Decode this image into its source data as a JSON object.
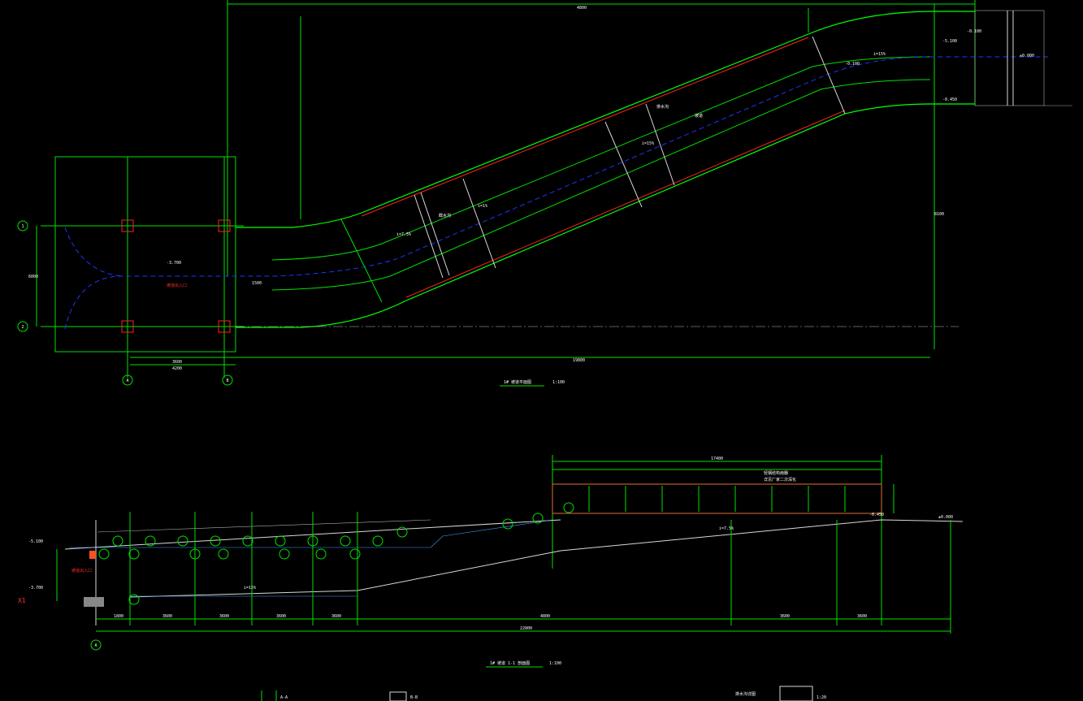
{
  "drawing": {
    "plan_title": "1# 坡道平面图",
    "plan_scale": "1:100",
    "section_title": "1# 坡道 1-1 剖面图",
    "section_scale": "1:100",
    "plan_axis_left_top": "1",
    "plan_axis_left_bottom": "2",
    "plan_axis_bottom_a": "A",
    "plan_axis_bottom_b": "B",
    "section_axis": "A",
    "plan_red_label": "坡道出入口",
    "section_red_label": "坡道出入口",
    "section_red_mark": "X1",
    "plan_labels": [
      "-3.700",
      "-0.100",
      "±0.000",
      "i=15%",
      "i=7.5%",
      "i=15%",
      "排水沟",
      "截水沟",
      "坡道",
      "i=1%",
      "-5.100",
      "-0.450",
      "-0.100"
    ],
    "plan_dims": [
      "4800",
      "3600",
      "19800",
      "6000",
      "4200",
      "1500",
      "8100"
    ],
    "section_labels": [
      "-5.100",
      "-3.700",
      "±0.000",
      "-0.450",
      "i=15%",
      "i=7.5%",
      "轻钢结构雨棚",
      "详见厂家二次深化"
    ],
    "section_dims": [
      "1800",
      "3600",
      "3600",
      "3600",
      "3600",
      "4800",
      "3600",
      "3600",
      "22800",
      "17400"
    ],
    "footer_labels": [
      "A-A",
      "B-B",
      "排水沟详图",
      "1:20"
    ]
  },
  "colors": {
    "background": "#000000",
    "structure": "#00e000",
    "centerline": "#2233ff",
    "edge": "#ff2020",
    "text": "#ffffff"
  }
}
